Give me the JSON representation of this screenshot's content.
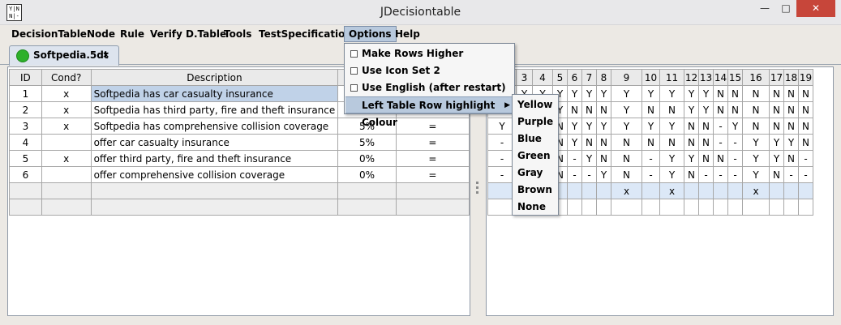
{
  "window": {
    "title": "JDecisiontable",
    "icon_text": "Y|N\nN|-",
    "controls": {
      "minimize": "—",
      "maximize": "□",
      "close": "✕"
    }
  },
  "menubar": [
    "DecisionTable",
    "Node",
    "Rule",
    "Verify D.Table",
    "Tools",
    "TestSpecification",
    "Options",
    "Help"
  ],
  "tab": {
    "label": "Softpedia.5dt",
    "close": "×"
  },
  "left_table": {
    "columns": [
      "ID",
      "Cond?",
      "Description",
      "",
      ""
    ],
    "rows": [
      [
        "1",
        "x",
        "Softpedia has car casualty insurance",
        "",
        ""
      ],
      [
        "2",
        "x",
        "Softpedia has third party, fire and theft insurance",
        "",
        ""
      ],
      [
        "3",
        "x",
        "Softpedia has comprehensive collision coverage",
        "5%",
        "="
      ],
      [
        "4",
        "",
        "offer car casualty insurance",
        "5%",
        "="
      ],
      [
        "5",
        "x",
        "offer third party, fire and theft insurance",
        "0%",
        "="
      ],
      [
        "6",
        "",
        "offer comprehensive collision coverage",
        "0%",
        "="
      ],
      [
        "",
        "",
        "",
        "",
        ""
      ],
      [
        "",
        "",
        "",
        "",
        ""
      ]
    ]
  },
  "right_table": {
    "columns": [
      "",
      "3",
      "4",
      "5",
      "6",
      "7",
      "8",
      "9",
      "10",
      "11",
      "12",
      "13",
      "14",
      "15",
      "16",
      "17",
      "18",
      "19"
    ],
    "rows": [
      [
        "",
        "Y",
        "Y",
        "Y",
        "Y",
        "Y",
        "Y",
        "Y",
        "Y",
        "Y",
        "Y",
        "Y",
        "N",
        "N",
        "N",
        "N",
        "N",
        "N"
      ],
      [
        "",
        "",
        "",
        "Y",
        "N",
        "N",
        "N",
        "Y",
        "N",
        "N",
        "Y",
        "Y",
        "N",
        "N",
        "N",
        "N",
        "N",
        "N"
      ],
      [
        "Y",
        "",
        "",
        "N",
        "Y",
        "Y",
        "Y",
        "Y",
        "Y",
        "Y",
        "N",
        "N",
        "-",
        "Y",
        "N",
        "N",
        "N",
        "N"
      ],
      [
        "-",
        "Y",
        "",
        "N",
        "Y",
        "N",
        "N",
        "N",
        "N",
        "N",
        "N",
        "N",
        "-",
        "-",
        "Y",
        "Y",
        "Y",
        "N"
      ],
      [
        "-",
        "-",
        "",
        "N",
        "-",
        "Y",
        "N",
        "N",
        "-",
        "Y",
        "Y",
        "N",
        "N",
        "-",
        "Y",
        "Y",
        "N",
        "-"
      ],
      [
        "-",
        "-",
        "",
        "N",
        "-",
        "-",
        "Y",
        "N",
        "-",
        "Y",
        "N",
        "-",
        "-",
        "-",
        "Y",
        "N",
        "-",
        "-"
      ],
      [
        "",
        "",
        "",
        "",
        "",
        "",
        "",
        "x",
        "",
        "x",
        "",
        "",
        "",
        "",
        "x",
        "",
        "",
        ""
      ],
      [
        "",
        "",
        "",
        "",
        "",
        "",
        "",
        "",
        "",
        "",
        "",
        "",
        "",
        "",
        "",
        "",
        "",
        ""
      ]
    ]
  },
  "options_menu": {
    "items": [
      {
        "label": "Make Rows Higher",
        "type": "checkbox"
      },
      {
        "label": "Use Icon Set 2",
        "type": "checkbox"
      },
      {
        "label": "Use English (after restart)",
        "type": "checkbox"
      },
      {
        "label": "Left Table Row highlight Colour",
        "type": "submenu"
      }
    ]
  },
  "colour_submenu": [
    "Yellow",
    "Purple",
    "Blue",
    "Green",
    "Gray",
    "Brown",
    "None"
  ],
  "colors": {
    "selection": "#c0d2e8",
    "menu_highlight": "#b8c9dd",
    "tab_status": "#2db02b"
  }
}
